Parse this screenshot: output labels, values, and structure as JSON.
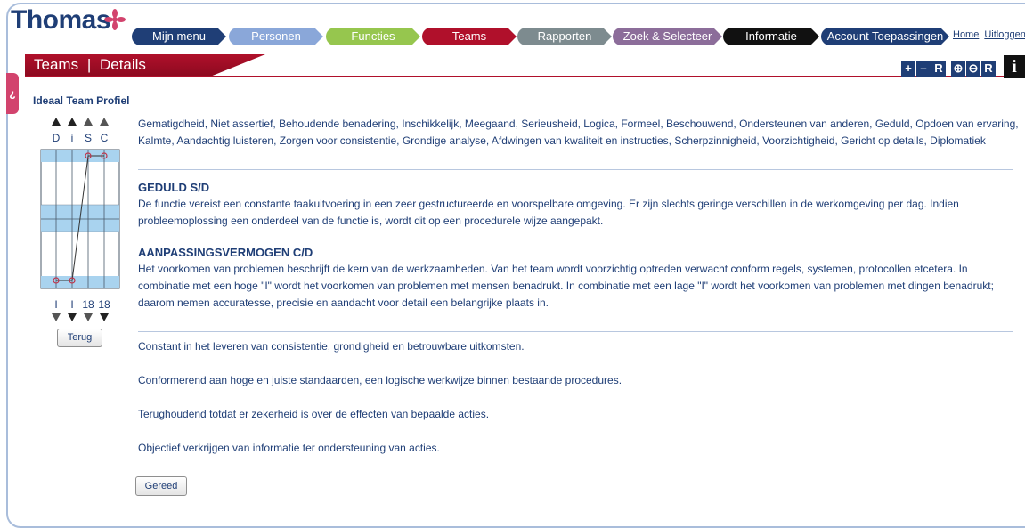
{
  "app": {
    "logo_text": "Thomas",
    "colors": {
      "navy": "#1f3e76",
      "red": "#b0102b",
      "accent": "#d2436d",
      "grid_blue": "#a9d3ef"
    }
  },
  "nav": {
    "tabs": [
      {
        "label": "Mijn menu",
        "color": "#1f3e76"
      },
      {
        "label": "Personen",
        "color": "#8aa7d9"
      },
      {
        "label": "Functies",
        "color": "#96c64e"
      },
      {
        "label": "Teams",
        "color": "#b0102b"
      },
      {
        "label": "Rapporten",
        "color": "#7d8b8f"
      },
      {
        "label": "Zoek & Selecteer",
        "color": "#8c6d9a"
      },
      {
        "label": "Informatie",
        "color": "#111111"
      },
      {
        "label": "Account Toepassingen",
        "color": "#1f3e76"
      }
    ],
    "links": {
      "home": "Home",
      "logout": "Uitloggen"
    }
  },
  "page": {
    "title_section": "Teams",
    "title_separator": "|",
    "title_sub": "Details",
    "side_tab_icon": "¿"
  },
  "toolbar": {
    "buttons": [
      {
        "label": "+",
        "name": "zoom-in-button"
      },
      {
        "label": "–",
        "name": "zoom-out-button"
      },
      {
        "label": "R",
        "name": "reset-button"
      },
      {
        "label": "⊕",
        "name": "magnify-in-icon"
      },
      {
        "label": "⊖",
        "name": "magnify-out-icon"
      },
      {
        "label": "R",
        "name": "magnify-reset-button"
      }
    ],
    "info_label": "i"
  },
  "profile": {
    "title": "Ideaal Team Profiel",
    "letters": [
      "D",
      "i",
      "S",
      "C"
    ],
    "bottom_labels": [
      "I",
      "I",
      "18",
      "18"
    ],
    "high_values": [
      0,
      0,
      1,
      1
    ],
    "low_values": [
      1,
      1,
      0,
      0
    ],
    "terug_label": "Terug"
  },
  "content": {
    "traits": "Gematigdheid, Niet assertief, Behoudende benadering, Inschikkelijk, Meegaand, Serieusheid, Logica, Formeel, Beschouwend, Ondersteunen van anderen, Geduld, Opdoen van ervaring, Kalmte, Aandachtig luisteren, Zorgen voor consistentie, Grondige analyse, Afdwingen van kwaliteit en instructies, Scherpzinnigheid, Voorzichtigheid, Gericht op details, Diplomatiek",
    "sections": [
      {
        "heading": "GEDULD S/D",
        "body": "De functie vereist een constante taakuitvoering in een zeer gestructureerde en voorspelbare omgeving. Er zijn slechts geringe verschillen in de werkomgeving per dag. Indien probleemoplossing een onderdeel van de functie is, wordt dit op een procedurele wijze aangepakt."
      },
      {
        "heading": "AANPASSINGSVERMOGEN C/D",
        "body": "Het voorkomen van problemen beschrijft de kern van de werkzaamheden. Van het team wordt voorzichtig optreden verwacht conform regels, systemen, protocollen etcetera. In combinatie met een hoge \"I\" wordt het voorkomen van problemen met mensen benadrukt. In combinatie met een lage \"I\" wordt het voorkomen van problemen met dingen benadrukt; daarom nemen accuratesse, precisie en aandacht voor detail een belangrijke plaats in."
      }
    ],
    "statements": [
      "Constant in het leveren van consistentie, grondigheid en betrouwbare uitkomsten.",
      "Conformerend aan hoge en juiste standaarden, een logische werkwijze binnen bestaande procedures.",
      "Terughoudend totdat er zekerheid is over de effecten van bepaalde acties.",
      "Objectief verkrijgen van informatie ter ondersteuning van acties."
    ],
    "gereed_label": "Gereed"
  }
}
